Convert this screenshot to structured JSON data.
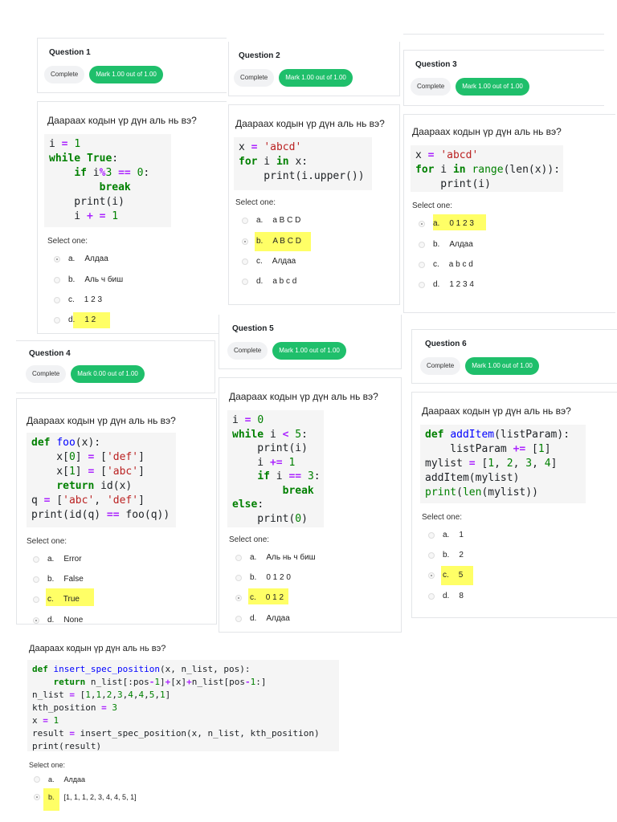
{
  "common": {
    "complete_label": "Complete",
    "question_text": "Даараах кодын үр дүн аль нь вэ?",
    "select_one": "Select one:"
  },
  "q1": {
    "title": "Question 1",
    "mark": "Mark 1.00 out of 1.00",
    "options": [
      {
        "letter": "a.",
        "text": "Алдаа",
        "selected": true
      },
      {
        "letter": "b.",
        "text": "Аль ч биш",
        "selected": false
      },
      {
        "letter": "c.",
        "text": "1 2 3",
        "selected": false
      },
      {
        "letter": "d.",
        "text": "1 2",
        "selected": false
      }
    ]
  },
  "q2": {
    "title": "Question 2",
    "mark": "Mark 1.00 out of 1.00",
    "options": [
      {
        "letter": "a.",
        "text": "a B C D",
        "selected": false
      },
      {
        "letter": "b.",
        "text": "A B C D",
        "selected": true
      },
      {
        "letter": "c.",
        "text": "Алдаа",
        "selected": false
      },
      {
        "letter": "d.",
        "text": "a b c d",
        "selected": false
      }
    ]
  },
  "q3": {
    "title": "Question 3",
    "mark": "Mark 1.00 out of 1.00",
    "options": [
      {
        "letter": "a.",
        "text": "0 1 2 3",
        "selected": true
      },
      {
        "letter": "b.",
        "text": "Алдаа",
        "selected": false
      },
      {
        "letter": "c.",
        "text": "a b c d",
        "selected": false
      },
      {
        "letter": "d.",
        "text": "1 2 3 4",
        "selected": false
      }
    ]
  },
  "q4": {
    "title": "Question 4",
    "mark": "Mark 0.00 out of 1.00",
    "options": [
      {
        "letter": "a.",
        "text": "Error",
        "selected": false
      },
      {
        "letter": "b.",
        "text": "False",
        "selected": false
      },
      {
        "letter": "c.",
        "text": "True",
        "selected": false
      },
      {
        "letter": "d.",
        "text": "None",
        "selected": true
      }
    ]
  },
  "q5": {
    "title": "Question 5",
    "mark": "Mark 1.00 out of 1.00",
    "options": [
      {
        "letter": "a.",
        "text": "Аль нь ч биш",
        "selected": false
      },
      {
        "letter": "b.",
        "text": "0 1 2 0",
        "selected": false
      },
      {
        "letter": "c.",
        "text": "0 1 2",
        "selected": true
      },
      {
        "letter": "d.",
        "text": "Алдаа",
        "selected": false
      }
    ]
  },
  "q6": {
    "title": "Question 6",
    "mark": "Mark 1.00 out of 1.00",
    "options": [
      {
        "letter": "a.",
        "text": "1",
        "selected": false
      },
      {
        "letter": "b.",
        "text": "2",
        "selected": false
      },
      {
        "letter": "c.",
        "text": "5",
        "selected": true
      },
      {
        "letter": "d.",
        "text": "8",
        "selected": false
      }
    ]
  },
  "q7": {
    "options": [
      {
        "letter": "a.",
        "text": "Алдаа",
        "selected": false
      },
      {
        "letter": "b.",
        "text": "[1, 1, 1, 2, 3, 4, 4, 5, 1]",
        "selected": true
      }
    ]
  }
}
